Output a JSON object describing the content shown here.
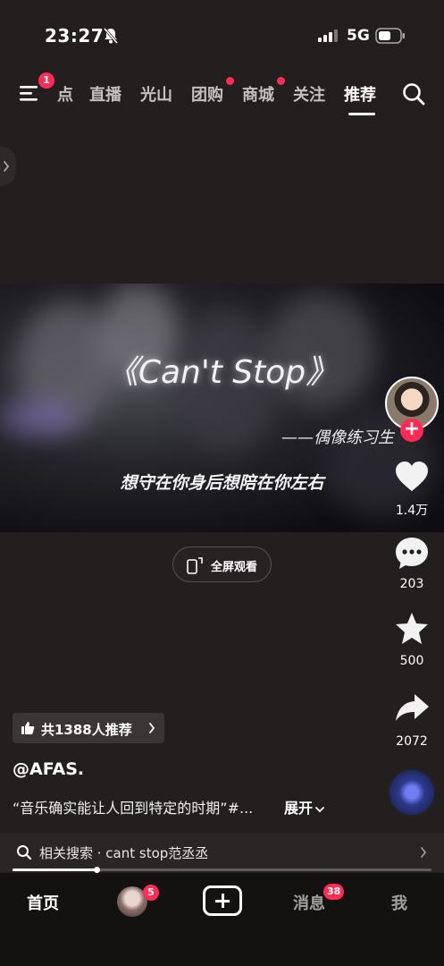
{
  "status_bar": {
    "time": "23:27",
    "network": "5G"
  },
  "top_nav": {
    "menu_badge": "1",
    "tabs": [
      {
        "label": "点",
        "has_dot": false,
        "active": false
      },
      {
        "label": "直播",
        "has_dot": false,
        "active": false
      },
      {
        "label": "光山",
        "has_dot": false,
        "active": false
      },
      {
        "label": "团购",
        "has_dot": true,
        "active": false
      },
      {
        "label": "商城",
        "has_dot": true,
        "active": false
      },
      {
        "label": "关注",
        "has_dot": false,
        "active": false
      },
      {
        "label": "推荐",
        "has_dot": false,
        "active": true
      }
    ]
  },
  "video": {
    "title": "《Can't Stop》",
    "subtitle": "——偶像练习生",
    "lyric": "想守在你身后想陪在你左右",
    "fullscreen_label": "全屏观看"
  },
  "actions": {
    "likes": "1.4万",
    "comments": "203",
    "favorites": "500",
    "shares": "2072"
  },
  "caption": {
    "recommend_label": "共1388人推荐",
    "author": "@AFAS.",
    "description": "“音乐确实能让人回到特定的时期”#...",
    "expand_label": "展开"
  },
  "related_search": {
    "label": "相关搜索 · cant stop范丞丞"
  },
  "playback_progress": 0.2,
  "bottom_bar": {
    "home": "首页",
    "friends_badge": "5",
    "messages": "消息",
    "messages_badge": "38",
    "me": "我"
  },
  "colors": {
    "accent": "#fe2c55",
    "background": "#241f1f",
    "tab_bar": "#141111"
  }
}
